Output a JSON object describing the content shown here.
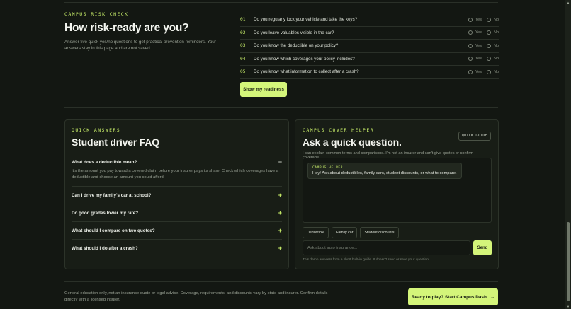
{
  "risk_check": {
    "eyebrow": "CAMPUS RISK CHECK",
    "title": "How risk-ready are you?",
    "description": "Answer five quick yes/no questions to get practical prevention reminders. Your answers stay in this page and are not saved.",
    "yes_label": "Yes",
    "no_label": "No",
    "questions": [
      {
        "num": "01",
        "text": "Do you regularly lock your vehicle and take the keys?"
      },
      {
        "num": "02",
        "text": "Do you leave valuables visible in the car?"
      },
      {
        "num": "03",
        "text": "Do you know the deductible on your policy?"
      },
      {
        "num": "04",
        "text": "Do you know which coverages your policy includes?"
      },
      {
        "num": "05",
        "text": "Do you know what information to collect after a crash?"
      }
    ],
    "button_label": "Show my readiness"
  },
  "faq": {
    "eyebrow": "QUICK ANSWERS",
    "title": "Student driver FAQ",
    "items": [
      {
        "question": "What does a deductible mean?",
        "toggle": "−",
        "answer": "It's the amount you pay toward a covered claim before your insurer pays its share. Check which coverages have a deductible and choose an amount you could afford."
      },
      {
        "question": "Can I drive my family's car at school?",
        "toggle": "+"
      },
      {
        "question": "Do good grades lower my rate?",
        "toggle": "+"
      },
      {
        "question": "What should I compare on two quotes?",
        "toggle": "+"
      },
      {
        "question": "What should I do after a crash?",
        "toggle": "+"
      }
    ]
  },
  "helper": {
    "eyebrow": "CAMPUS COVER HELPER",
    "title": "Ask a quick question.",
    "badge": "QUICK GUIDE",
    "description": "I can explain common terms and comparisons. I'm not an insurer and can't give quotes or confirm coverage.",
    "bubble_label": "CAMPUS HELPER",
    "bubble_text": "Hey! Ask about deductibles, family cars, student discounts, or what to compare.",
    "chips": [
      "Deductible",
      "Family car",
      "Student discounts"
    ],
    "input_placeholder": "Ask about auto insurance...",
    "send_label": "Send",
    "note": "This demo answers from a short built-in guide. It doesn't send or save your question."
  },
  "footer": {
    "disclaimer": "General education only, not an insurance quote or legal advice. Coverage, requirements, and discounts vary by state and insurer. Confirm details directly with a licensed insurer.",
    "cta_label": "Ready to play? Start Campus Dash",
    "cta_arrow": "→"
  },
  "colors": {
    "accent": "#d4f57a",
    "background": "#131712",
    "panel": "#181d16"
  }
}
